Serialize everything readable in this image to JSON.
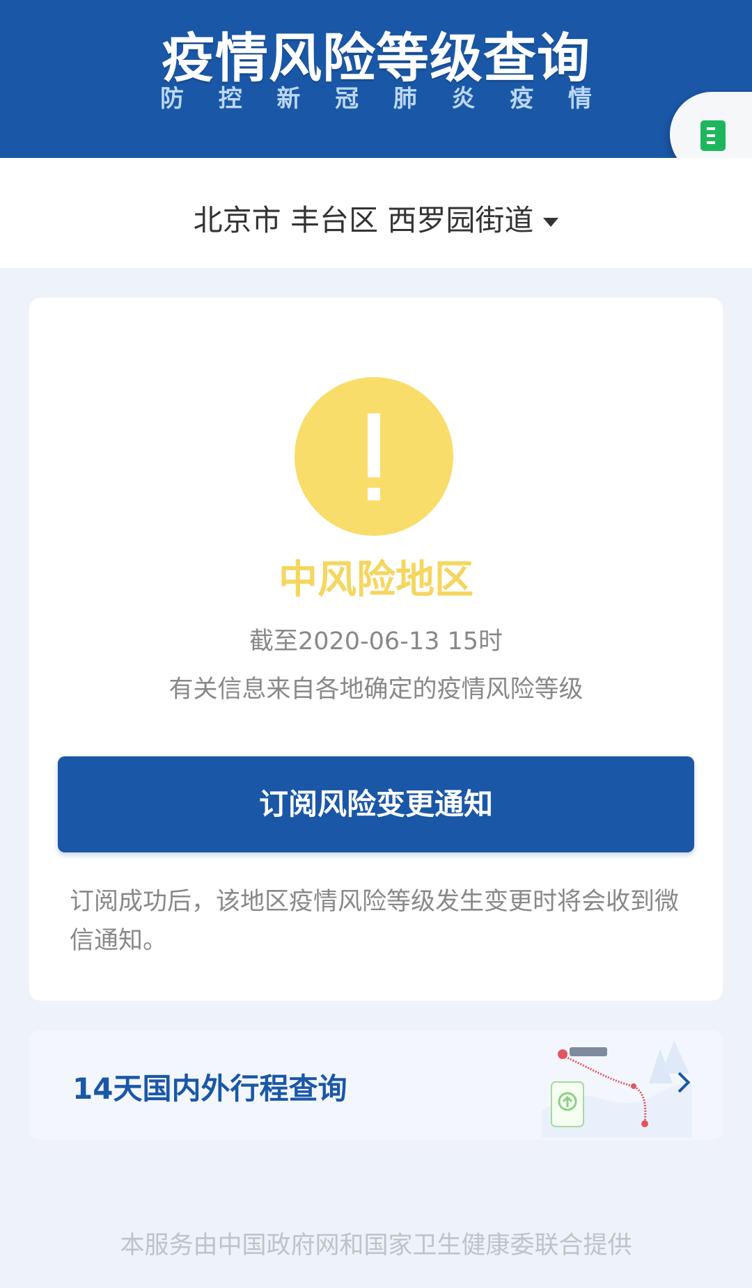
{
  "header": {
    "title": "疫情风险等级查询",
    "subtitle_chars": [
      "防",
      "控",
      "新",
      "冠",
      "肺",
      "炎",
      "疫",
      "情"
    ]
  },
  "side_tab": {
    "icon": "document-icon",
    "icon_color": "#1eb65c"
  },
  "location": {
    "text": "北京市 丰台区 西罗园街道",
    "icon": "caret-down-icon"
  },
  "status": {
    "icon": "warning-icon",
    "level": "中风险地区",
    "as_of": "截至2020-06-13 15时",
    "note": "有关信息来自各地确定的疫情风险等级",
    "color": "#f8dd6b"
  },
  "subscribe": {
    "button_label": "订阅风险变更通知",
    "note": "订阅成功后，该地区疫情风险等级发生变更时将会收到微信通知。"
  },
  "trip": {
    "label": "14天国内外行程查询",
    "illustration": "route-map-illustration",
    "icon": "chevron-right-icon"
  },
  "footer": {
    "text": "本服务由中国政府网和国家卫生健康委联合提供"
  },
  "colors": {
    "brand_blue": "#1a57a6",
    "page_background": "#eef3f9",
    "muted_text": "#888888"
  }
}
